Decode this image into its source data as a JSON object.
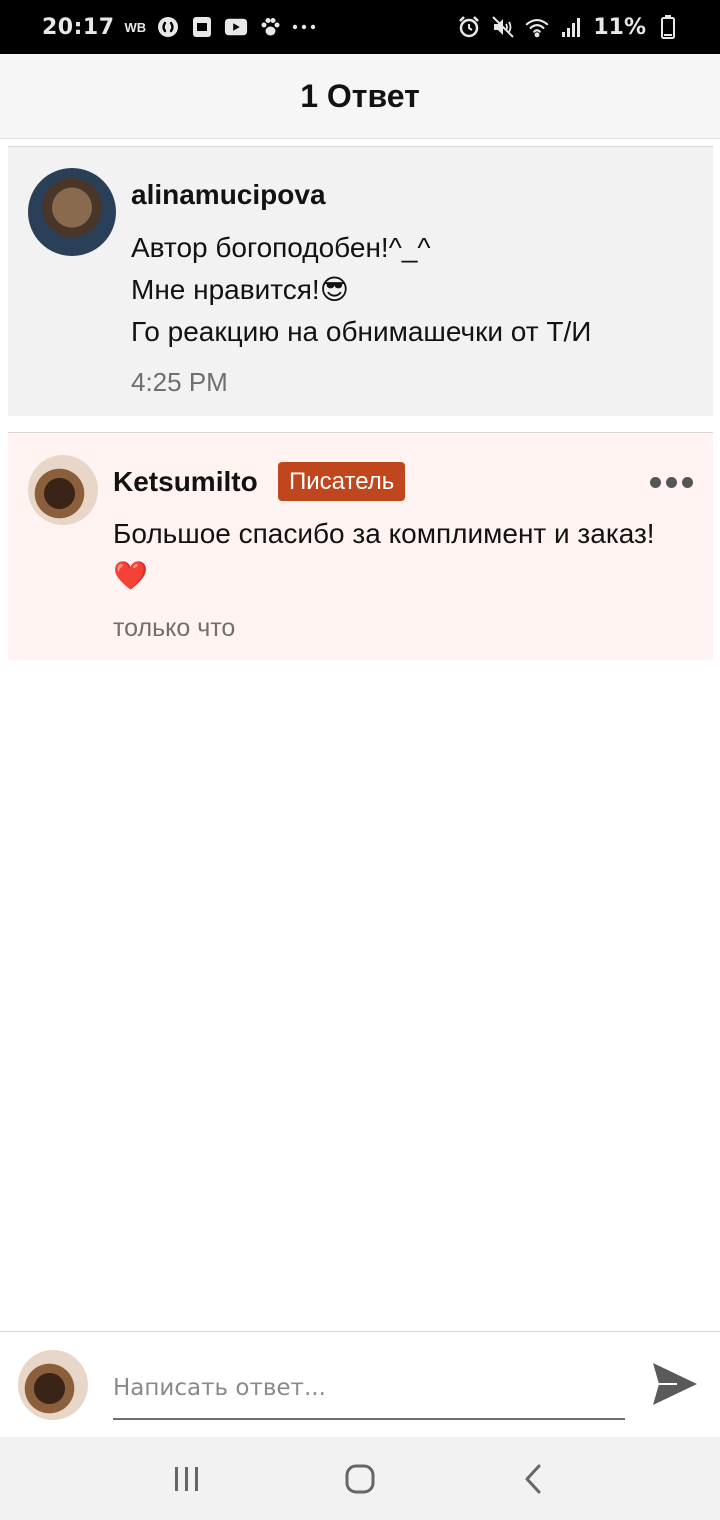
{
  "status_bar": {
    "time": "20:17",
    "carrier": "WB",
    "battery": "11%",
    "icons": [
      "shazam-icon",
      "screen-icon",
      "youtube-icon",
      "paw-icon",
      "more-dots-icon",
      "alarm-icon",
      "mute-icon",
      "wifi-icon",
      "signal-icon",
      "battery-icon"
    ]
  },
  "header": {
    "title": "1 Ответ"
  },
  "original_comment": {
    "username": "alinamucipova",
    "text": "Автор богоподобен!^_^\nМне нравится!😎\nГо реакцию на обнимашечки от Т/И",
    "time": "4:25 PM"
  },
  "reply": {
    "username": "Ketsumilto",
    "badge": "Писатель",
    "text": "Большое спасибо за комплимент и заказ!\n❤️",
    "time": "только что"
  },
  "composer": {
    "placeholder": "Написать ответ..."
  },
  "colors": {
    "badge": "#c0461e",
    "reply_bg": "#fff4f1",
    "orig_bg": "#f2f2f2"
  }
}
